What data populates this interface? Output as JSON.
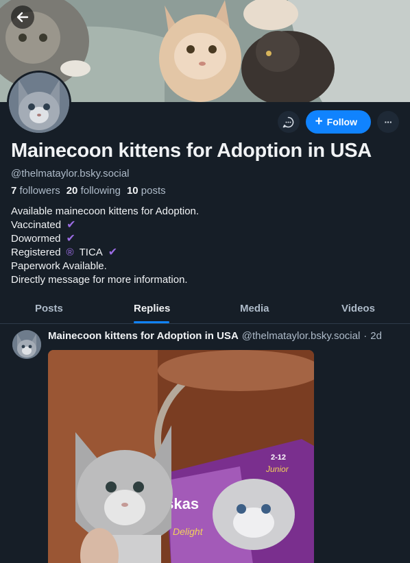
{
  "profile": {
    "display_name": "Mainecoon kittens for Adoption in USA",
    "handle": "@thelmataylor.bsky.social",
    "followers_count": "7",
    "followers_label": "followers",
    "following_count": "20",
    "following_label": "following",
    "posts_count": "10",
    "posts_label": "posts"
  },
  "actions": {
    "follow_label": "Follow",
    "follow_icon": "+",
    "more_icon": "···"
  },
  "bio": {
    "line1": "Available mainecoon kittens for Adoption.",
    "line2": "Vaccinated",
    "line3": "Dowormed",
    "line4_a": "Registered",
    "line4_reg": "®",
    "line4_b": "TICA",
    "line5": "Paperwork Available.",
    "line6": "Directly message for more information.",
    "check": "✔"
  },
  "tabs": [
    {
      "label": "Posts"
    },
    {
      "label": "Replies"
    },
    {
      "label": "Media"
    },
    {
      "label": "Videos"
    }
  ],
  "active_tab": "Replies",
  "post": {
    "author": "Mainecoon kittens for Adoption in USA",
    "handle": "@thelmataylor.bsky.social",
    "separator": "·",
    "time": "2d",
    "image_text_a": "2-12",
    "image_text_b": "Junior",
    "image_text_c": "iskas",
    "image_text_d": "Delight"
  },
  "colors": {
    "background": "#161e27",
    "accent": "#1083fe",
    "verified_purple": "#9b6ce3",
    "muted_text": "#aebbc9"
  }
}
